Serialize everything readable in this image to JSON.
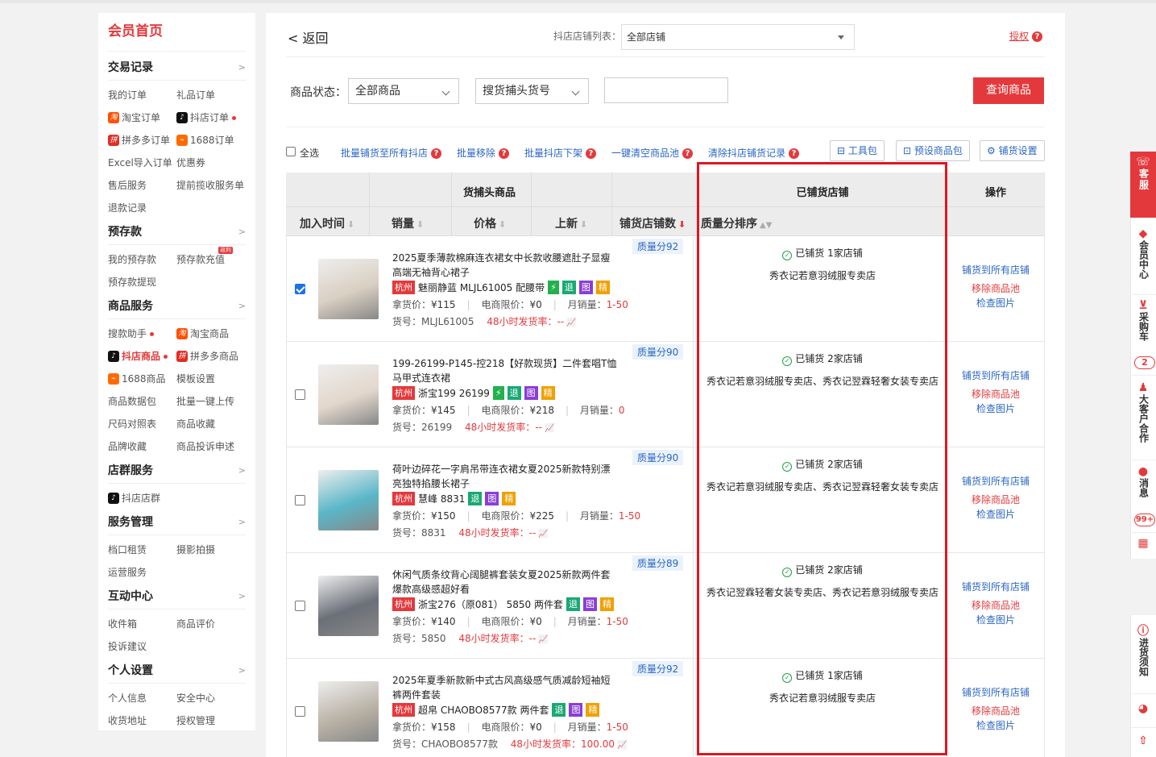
{
  "sidebar": {
    "home": "会员首页",
    "sections": [
      {
        "title": "交易记录",
        "links": [
          "我的订单",
          "礼品订单",
          "淘宝订单",
          "抖店订单",
          "拼多多订单",
          "1688订单",
          "Excel导入订单",
          "优惠券",
          "售后服务",
          "提前揽收服务单",
          "退款记录"
        ]
      },
      {
        "title": "预存款",
        "links": [
          "我的预存款",
          "预存款充值",
          "预存款提现"
        ],
        "badge": "返利"
      },
      {
        "title": "商品服务",
        "links": [
          "搜款助手",
          "淘宝商品",
          "抖店商品",
          "拼多多商品",
          "1688商品",
          "模板设置",
          "商品数据包",
          "批量一键上传",
          "尺码对照表",
          "商品收藏",
          "品牌收藏",
          "商品投诉申述"
        ]
      },
      {
        "title": "店群服务",
        "links": [
          "抖店店群"
        ]
      },
      {
        "title": "服务管理",
        "links": [
          "档口租赁",
          "摄影拍摄",
          "运营服务"
        ]
      },
      {
        "title": "互动中心",
        "links": [
          "收件箱",
          "商品评价",
          "投诉建议"
        ]
      },
      {
        "title": "个人设置",
        "links": [
          "个人信息",
          "安全中心",
          "收货地址",
          "授权管理"
        ]
      }
    ],
    "arrow": ">"
  },
  "header": {
    "back": "< 返回",
    "shop_label": "抖店店铺列表：",
    "shop_value": "全部店铺",
    "auth": "授权",
    "q": "?"
  },
  "filter": {
    "status_label": "商品状态：",
    "status_value": "全部商品",
    "type_value": "搜货捕头货号",
    "query_button": "查询商品"
  },
  "toolbar": {
    "select_all": "全选",
    "links": [
      "批量铺货至所有抖店",
      "批量移除",
      "批量抖店下架",
      "一键清空商品池",
      "清除抖店铺货记录"
    ],
    "buttons": [
      "工具包",
      "预设商品包",
      "铺货设置"
    ]
  },
  "table": {
    "head_goods": "货捕头商品",
    "head_shops": "已铺货店铺",
    "head_ops": "操作",
    "sorts": [
      "加入时间",
      "销量",
      "价格",
      "上新",
      "铺货店铺数",
      "质量分排序"
    ],
    "labels": {
      "price": "拿货价：",
      "limit": "电商限价：",
      "monthly": "月销量：",
      "code": "货号：",
      "rate": "48小时发货率："
    },
    "ops": [
      "铺货到所有店铺",
      "移除商品池",
      "检查图片"
    ],
    "rows": [
      {
        "checked": true,
        "quality": "质量分92",
        "title": "2025夏季薄款棉麻连衣裙女中长款收腰遮肚子显瘦高端无袖背心裙子",
        "city": "杭州",
        "shop": "魅丽静蓝 MLJL61005 配腰带",
        "tags": [
          "⚡",
          "退",
          "图",
          "精"
        ],
        "price": "¥115",
        "limit": "¥0",
        "monthly": "1-50",
        "code": "MLJL61005",
        "rate": "--",
        "status": "已铺货 1家店铺",
        "shops": "秀衣记若意羽绒服专卖店",
        "color": "#d9cfc2"
      },
      {
        "checked": false,
        "quality": "质量分90",
        "title": "199-26199-P145-控218【好款现货】二件套唱T恤马甲式连衣裙",
        "city": "杭州",
        "shop": "浙宝199 26199",
        "tags": [
          "⚡",
          "退",
          "图",
          "精"
        ],
        "price": "¥145",
        "limit": "¥218",
        "monthly": "0",
        "code": "26199",
        "rate": "--",
        "status": "已铺货 2家店铺",
        "shops": "秀衣记若意羽绒服专卖店、秀衣记翌霖轻奢女装专卖店",
        "color": "#e2d7cc"
      },
      {
        "checked": false,
        "quality": "质量分90",
        "title": "荷叶边碎花一字肩吊带连衣裙女夏2025新款特别漂亮独特掐腰长裙子",
        "city": "杭州",
        "shop": "慧峰 8831",
        "tags": [
          "退",
          "图",
          "精"
        ],
        "price": "¥150",
        "limit": "¥225",
        "monthly": "1-50",
        "code": "8831",
        "rate": "--",
        "status": "已铺货 2家店铺",
        "shops": "秀衣记若意羽绒服专卖店、秀衣记翌霖轻奢女装专卖店",
        "color": "#5ab6c8"
      },
      {
        "checked": false,
        "quality": "质量分89",
        "title": "休闲气质条纹背心阔腿裤套装女夏2025新款两件套爆款高级感超好看",
        "city": "杭州",
        "shop": "浙宝276（原081） 5850 两件套",
        "tags": [
          "退",
          "图",
          "精"
        ],
        "price": "¥140",
        "limit": "¥0",
        "monthly": "1-50",
        "code": "5850",
        "rate": "--",
        "status": "已铺货 2家店铺",
        "shops": "秀衣记翌霖轻奢女装专卖店、秀衣记若意羽绒服专卖店",
        "color": "#6b6f78"
      },
      {
        "checked": false,
        "quality": "质量分92",
        "title": "2025年夏季新款新中式古风高级感气质减龄短袖短裤两件套装",
        "city": "杭州",
        "shop": "超帛 CHAOBO8577款 两件套",
        "tags": [
          "退",
          "图",
          "精"
        ],
        "price": "¥158",
        "limit": "¥0",
        "monthly": "1-50",
        "code": "CHAOBO8577款",
        "rate": "100.00",
        "status": "已铺货 1家店铺",
        "shops": "秀衣记若意羽绒服专卖店",
        "color": "#b9b2a6"
      }
    ]
  },
  "rightbar": {
    "service": "客服",
    "member": "会员中心",
    "cart": "采购车",
    "cart_count": "2",
    "bigclient": "大客户合作",
    "msg": "消息",
    "msg_count": "99+",
    "notice": "进货须知"
  }
}
